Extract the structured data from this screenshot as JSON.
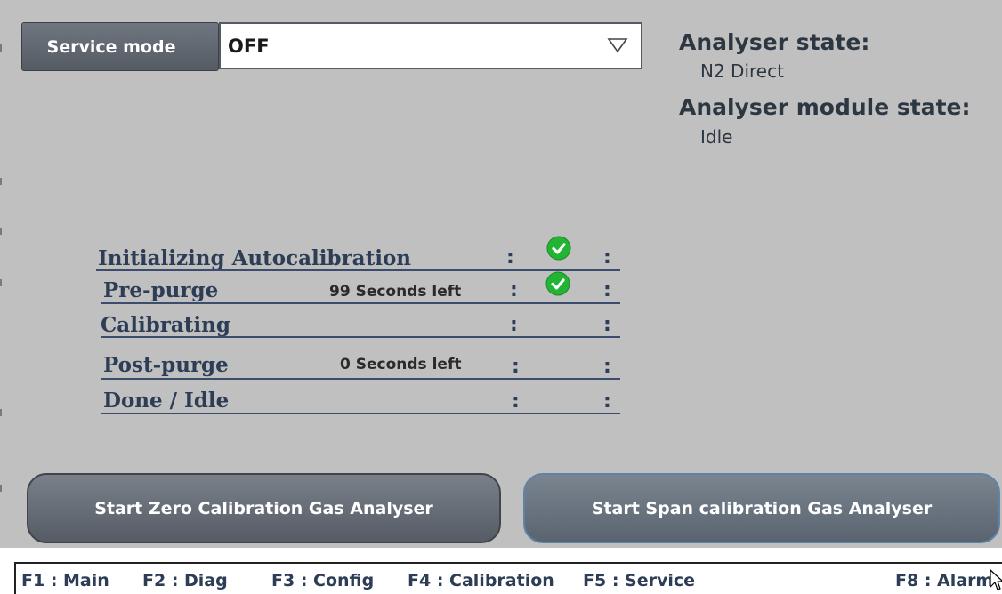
{
  "service": {
    "label": "Service mode",
    "value": "OFF"
  },
  "analyser": {
    "state_title": "Analyser state:",
    "state_value": "N2 Direct",
    "module_title": "Analyser module state:",
    "module_value": "Idle"
  },
  "steps": [
    {
      "label": "Initializing Autocalibration",
      "sub": "",
      "done": true
    },
    {
      "label": "Pre-purge",
      "sub": "99 Seconds left",
      "done": true
    },
    {
      "label": "Calibrating",
      "sub": "",
      "done": false
    },
    {
      "label": "Post-purge",
      "sub": "0 Seconds left",
      "done": false
    },
    {
      "label": "Done / Idle",
      "sub": "",
      "done": false
    }
  ],
  "colon": ":",
  "buttons": {
    "zero": "Start Zero Calibration Gas Analyser",
    "span": "Start Span calibration Gas Analyser"
  },
  "function_keys": [
    "F1 : Main",
    "F2 : Diag",
    "F3 : Config",
    "F4 : Calibration",
    "F5 : Service",
    "F8 : Alarm"
  ],
  "colors": {
    "panel_background": "#c0c0c0",
    "check_green": "#22b534",
    "button_dark": "#5f656e",
    "text_navy": "#2c3d55"
  }
}
